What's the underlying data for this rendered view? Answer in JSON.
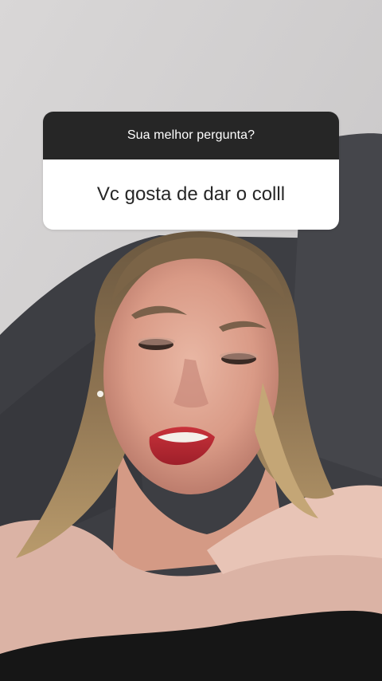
{
  "story": {
    "question_sticker": {
      "prompt": "Sua melhor pergunta?",
      "answer": "Vc gosta de dar o colll"
    },
    "colors": {
      "sticker_header_bg": "#262626",
      "sticker_body_bg": "#ffffff",
      "sticker_text_dark": "#262626",
      "wall": "#d6d4d4",
      "couch": "#3d3e43"
    }
  }
}
